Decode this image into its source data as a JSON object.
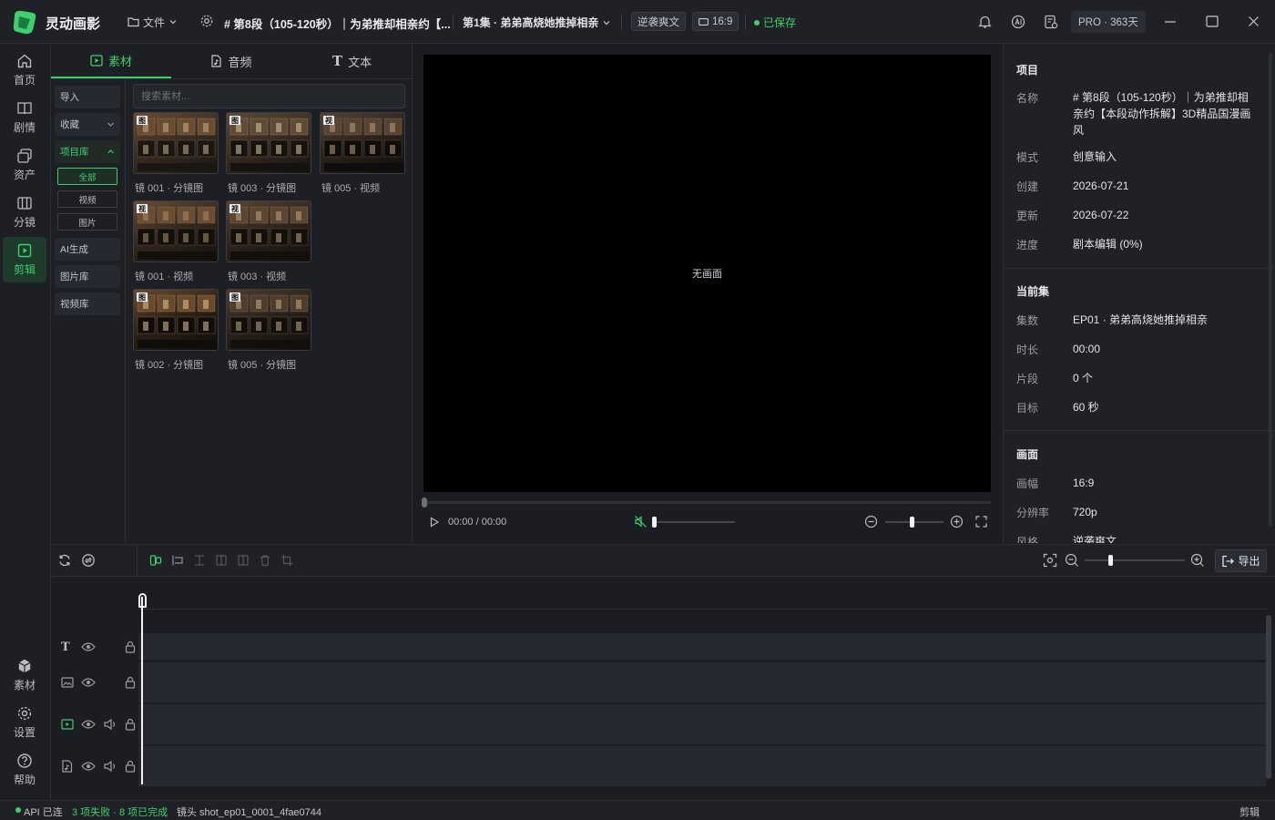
{
  "titlebar": {
    "app_name": "灵动画影",
    "file_menu": "文件",
    "segment_title": "# 第8段（105-120秒）｜为弟推却相亲约【...",
    "episode": "第1集 · 弟弟高烧她推掉相亲",
    "style_chip": "逆袭爽文",
    "ratio_chip": "16:9",
    "saved": "已保存",
    "pro": "PRO · 363天"
  },
  "nav": {
    "home": "首页",
    "plot": "剧情",
    "assets": "资产",
    "storyboard": "分镜",
    "edit": "剪辑",
    "material": "素材",
    "settings": "设置",
    "help": "帮助"
  },
  "media": {
    "tabs": [
      "素材",
      "音频",
      "文本"
    ],
    "categories": {
      "import": "导入",
      "favorites": "收藏",
      "project_lib": "项目库",
      "all": "全部",
      "video": "视频",
      "image": "图片",
      "ai_gen": "AI生成",
      "image_lib": "图片库",
      "video_lib": "视频库"
    },
    "search_placeholder": "搜索素材...",
    "items": [
      {
        "label": "镜 001 · 分镜图",
        "tag": "图"
      },
      {
        "label": "镜 003 · 分镜图",
        "tag": "图"
      },
      {
        "label": "镜 005 · 视频",
        "tag": "视"
      },
      {
        "label": "镜 001 · 视频",
        "tag": "视"
      },
      {
        "label": "镜 003 · 视频",
        "tag": "视"
      },
      {
        "label": "镜 002 · 分镜图",
        "tag": "图"
      },
      {
        "label": "镜 005 · 分镜图",
        "tag": "图"
      }
    ]
  },
  "preview": {
    "empty": "无画面",
    "time": "00:00 / 00:00",
    "volume": 0,
    "zoom": 0.45
  },
  "info": {
    "project_title": "项目",
    "project": [
      {
        "k": "名称",
        "v": "# 第8段（105-120秒）｜为弟推却相亲约【本段动作拆解】3D精品国漫画风"
      },
      {
        "k": "模式",
        "v": "创意输入"
      },
      {
        "k": "创建",
        "v": "2026-07-21"
      },
      {
        "k": "更新",
        "v": "2026-07-22"
      },
      {
        "k": "进度",
        "v": "剧本编辑 (0%)"
      }
    ],
    "episode_title": "当前集",
    "episode": [
      {
        "k": "集数",
        "v": "EP01 · 弟弟高烧她推掉相亲"
      },
      {
        "k": "时长",
        "v": "00:00"
      },
      {
        "k": "片段",
        "v": "0 个"
      },
      {
        "k": "目标",
        "v": "60 秒"
      }
    ],
    "canvas_title": "画面",
    "canvas": [
      {
        "k": "画幅",
        "v": "16:9"
      },
      {
        "k": "分辨率",
        "v": "720p"
      },
      {
        "k": "风格",
        "v": "逆袭爽文"
      }
    ]
  },
  "timeline": {
    "export": "导出",
    "zoom": 0.25
  },
  "status": {
    "api": "API 已连",
    "jobs": "3 项失败 · 8 项已完成",
    "shot": "镜头 shot_ep01_0001_4fae0744",
    "mode": "剪辑"
  },
  "colors": {
    "accent": "#3fcf6e",
    "background": "#1b1d22",
    "panel": "#1f2126"
  }
}
